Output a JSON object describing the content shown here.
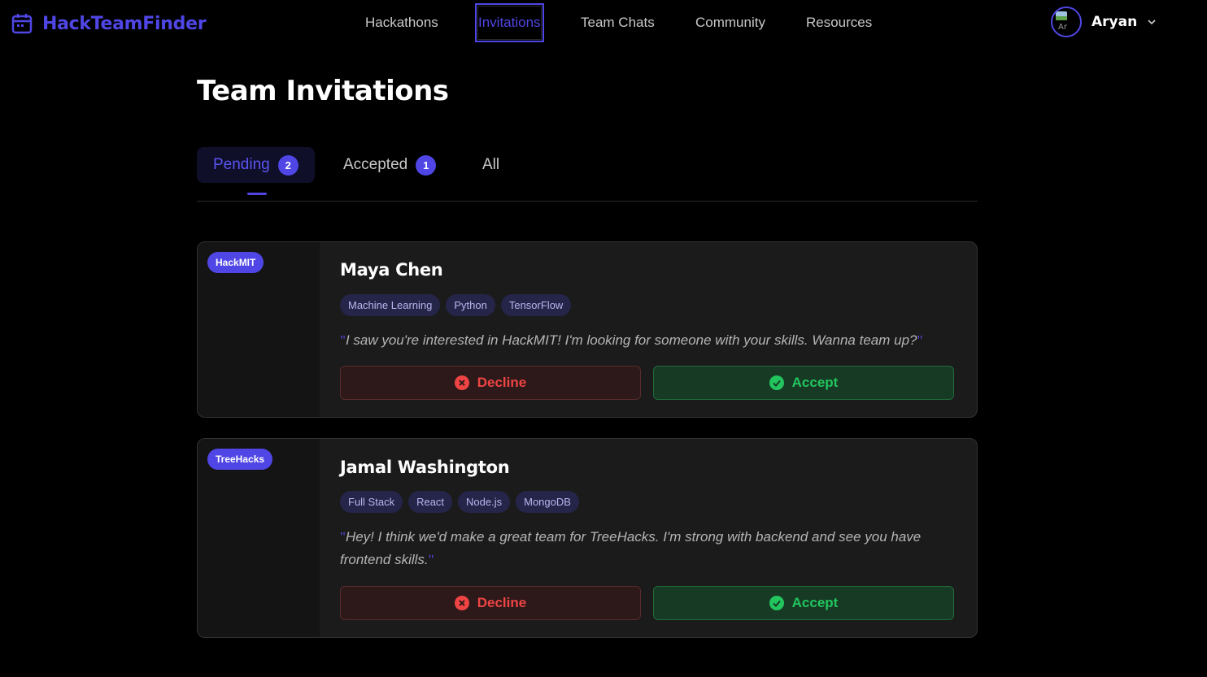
{
  "app": {
    "name": "HackTeamFinder",
    "accent": "#4f46e5"
  },
  "nav": {
    "items": [
      {
        "label": "Hackathons",
        "active": false
      },
      {
        "label": "Invitations",
        "active": true
      },
      {
        "label": "Team Chats",
        "active": false
      },
      {
        "label": "Community",
        "active": false
      },
      {
        "label": "Resources",
        "active": false
      }
    ]
  },
  "user": {
    "name": "Aryan",
    "avatar_alt": "Ar"
  },
  "page": {
    "title": "Team Invitations"
  },
  "tabs": [
    {
      "label": "Pending",
      "count": "2",
      "active": true
    },
    {
      "label": "Accepted",
      "count": "1",
      "active": false
    },
    {
      "label": "All",
      "count": null,
      "active": false
    }
  ],
  "invitations": [
    {
      "event": "HackMIT",
      "name": "Maya Chen",
      "skills": [
        "Machine Learning",
        "Python",
        "TensorFlow"
      ],
      "message": "I saw you're interested in HackMIT! I'm looking for someone with your skills. Wanna team up?",
      "decline_label": "Decline",
      "accept_label": "Accept"
    },
    {
      "event": "TreeHacks",
      "name": "Jamal Washington",
      "skills": [
        "Full Stack",
        "React",
        "Node.js",
        "MongoDB"
      ],
      "message": "Hey! I think we'd make a great team for TreeHacks. I'm strong with backend and see you have frontend skills.",
      "decline_label": "Decline",
      "accept_label": "Accept"
    }
  ],
  "colors": {
    "decline": "#ef4444",
    "accept": "#22c55e",
    "card_bg": "#1b1b1b"
  }
}
